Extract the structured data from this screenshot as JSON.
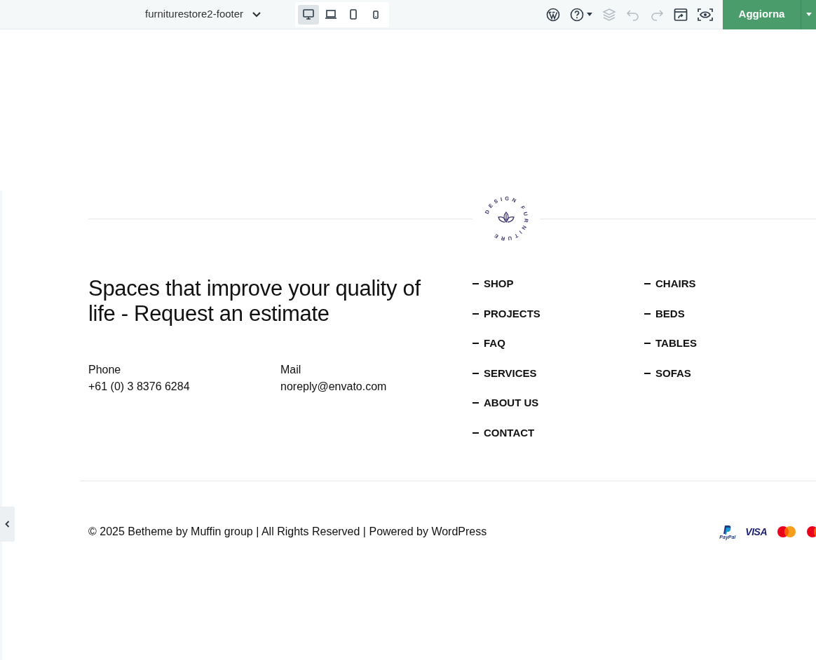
{
  "toolbar": {
    "template_name": "furniturestore2-footer",
    "devices": [
      {
        "kind": "desktop",
        "selected": true
      },
      {
        "kind": "laptop",
        "selected": false
      },
      {
        "kind": "tablet",
        "selected": false
      },
      {
        "kind": "mobile",
        "selected": false
      }
    ],
    "tools": [
      {
        "kind": "wordpress",
        "disabled": false
      },
      {
        "kind": "help",
        "disabled": false
      },
      {
        "kind": "layers",
        "disabled": true
      },
      {
        "kind": "undo",
        "disabled": true
      },
      {
        "kind": "redo",
        "disabled": true
      },
      {
        "kind": "export",
        "disabled": false
      },
      {
        "kind": "preview",
        "disabled": false
      }
    ],
    "update_button": "Aggiorna"
  },
  "footer": {
    "logo_text": "DESIGN FURNITURE",
    "heading": "Spaces that improve your quality of life - Request an estimate",
    "contacts": [
      {
        "label": "Phone",
        "value": "+61 (0) 3 8376 6284"
      },
      {
        "label": "Mail",
        "value": "noreply@envato.com"
      }
    ],
    "menus": [
      [
        "SHOP",
        "PROJECTS",
        "FAQ",
        "SERVICES",
        "ABOUT US",
        "CONTACT"
      ],
      [
        "CHAIRS",
        "BEDS",
        "TABLES",
        "SOFAS"
      ]
    ],
    "copyright": "© 2025 Betheme by Muffin group | All Rights Reserved | Powered by WordPress",
    "payments": [
      {
        "kind": "paypal",
        "label": "PayPal"
      },
      {
        "kind": "visa",
        "label": "VISA"
      },
      {
        "kind": "mastercard"
      },
      {
        "kind": "mastercard"
      }
    ]
  }
}
